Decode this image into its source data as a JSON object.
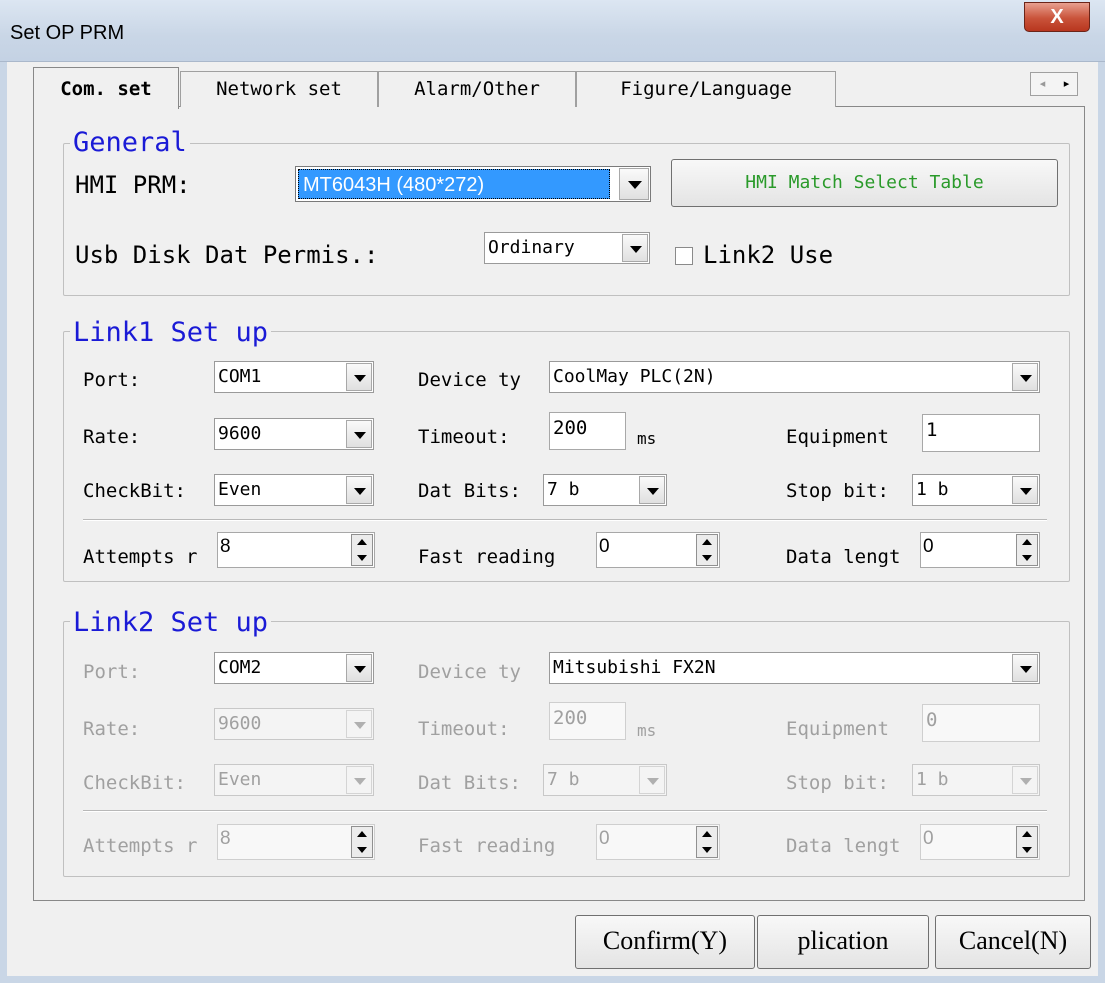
{
  "window": {
    "title": "Set OP PRM",
    "close_label": "X"
  },
  "tabs": [
    {
      "label": "Com. set"
    },
    {
      "label": "Network set"
    },
    {
      "label": "Alarm/Other"
    },
    {
      "label": "Figure/Language"
    }
  ],
  "tab_scroll": {
    "left": "◂",
    "right": "▸"
  },
  "general": {
    "title": "General",
    "hmi_label": "HMI PRM:",
    "hmi_value": "MT6043H (480*272)",
    "match_button": "HMI Match Select Table",
    "usb_label": "Usb Disk Dat Permis.:",
    "usb_value": "Ordinary",
    "link2_use_label": "Link2 Use",
    "link2_use_checked": false
  },
  "link1": {
    "title": "Link1 Set up",
    "port_label": "Port:",
    "port_value": "COM1",
    "device_label": "Device ty",
    "device_value": "CoolMay PLC(2N)",
    "rate_label": "Rate:",
    "rate_value": "9600",
    "timeout_label": "Timeout:",
    "timeout_value": "200",
    "timeout_unit": "ms",
    "equipment_label": "Equipment",
    "equipment_value": "1",
    "checkbit_label": "CheckBit:",
    "checkbit_value": "Even",
    "datbits_label": "Dat Bits:",
    "datbits_value": "7 b",
    "stopbit_label": "Stop bit:",
    "stopbit_value": "1 b",
    "attempts_label": "Attempts r",
    "attempts_value": "8",
    "fast_label": "Fast reading",
    "fast_value": "0",
    "datalen_label": "Data lengt",
    "datalen_value": "0"
  },
  "link2": {
    "title": "Link2 Set up",
    "port_label": "Port:",
    "port_value": "COM2",
    "device_label": "Device ty",
    "device_value": "Mitsubishi FX2N",
    "rate_label": "Rate:",
    "rate_value": "9600",
    "timeout_label": "Timeout:",
    "timeout_value": "200",
    "timeout_unit": "ms",
    "equipment_label": "Equipment",
    "equipment_value": "0",
    "checkbit_label": "CheckBit:",
    "checkbit_value": "Even",
    "datbits_label": "Dat Bits:",
    "datbits_value": "7 b",
    "stopbit_label": "Stop bit:",
    "stopbit_value": "1 b",
    "attempts_label": "Attempts r",
    "attempts_value": "8",
    "fast_label": "Fast reading",
    "fast_value": "0",
    "datalen_label": "Data lengt",
    "datalen_value": "0"
  },
  "footer": {
    "confirm": "Confirm(Y)",
    "application": "plication",
    "cancel": "Cancel(N)"
  }
}
